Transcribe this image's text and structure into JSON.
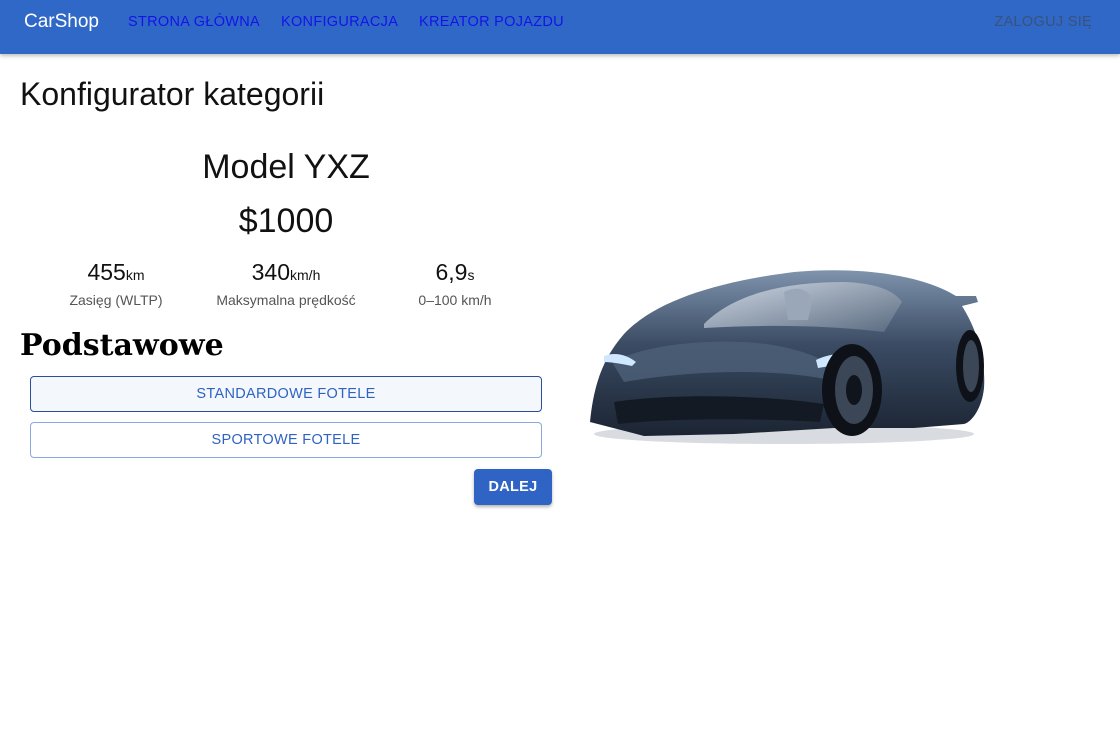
{
  "header": {
    "brand": "CarShop",
    "nav": [
      "STRONA GŁÓWNA",
      "KONFIGURACJA",
      "KREATOR POJAZDU"
    ],
    "login": "ZALOGUJ SIĘ"
  },
  "page": {
    "title": "Konfigurator kategorii"
  },
  "car": {
    "model": "Model YXZ",
    "price": "$1000",
    "specs": [
      {
        "value": "455",
        "unit": "km",
        "label": "Zasięg (WLTP)"
      },
      {
        "value": "340",
        "unit": "km/h",
        "label": "Maksymalna prędkość"
      },
      {
        "value": "6,9",
        "unit": "s",
        "label": "0–100 km/h"
      }
    ]
  },
  "section": {
    "title": "Podstawowe",
    "options": [
      {
        "label": "STANDARDOWE FOTELE",
        "selected": true
      },
      {
        "label": "SPORTOWE FOTELE",
        "selected": false
      }
    ],
    "next": "DALEJ"
  },
  "colors": {
    "appbar": "#3068c8",
    "accent": "#2f63c2",
    "nav_link": "#1414e6",
    "car_body": "#2b3a4e"
  },
  "icons": {
    "car_image": "sports-car-image"
  }
}
